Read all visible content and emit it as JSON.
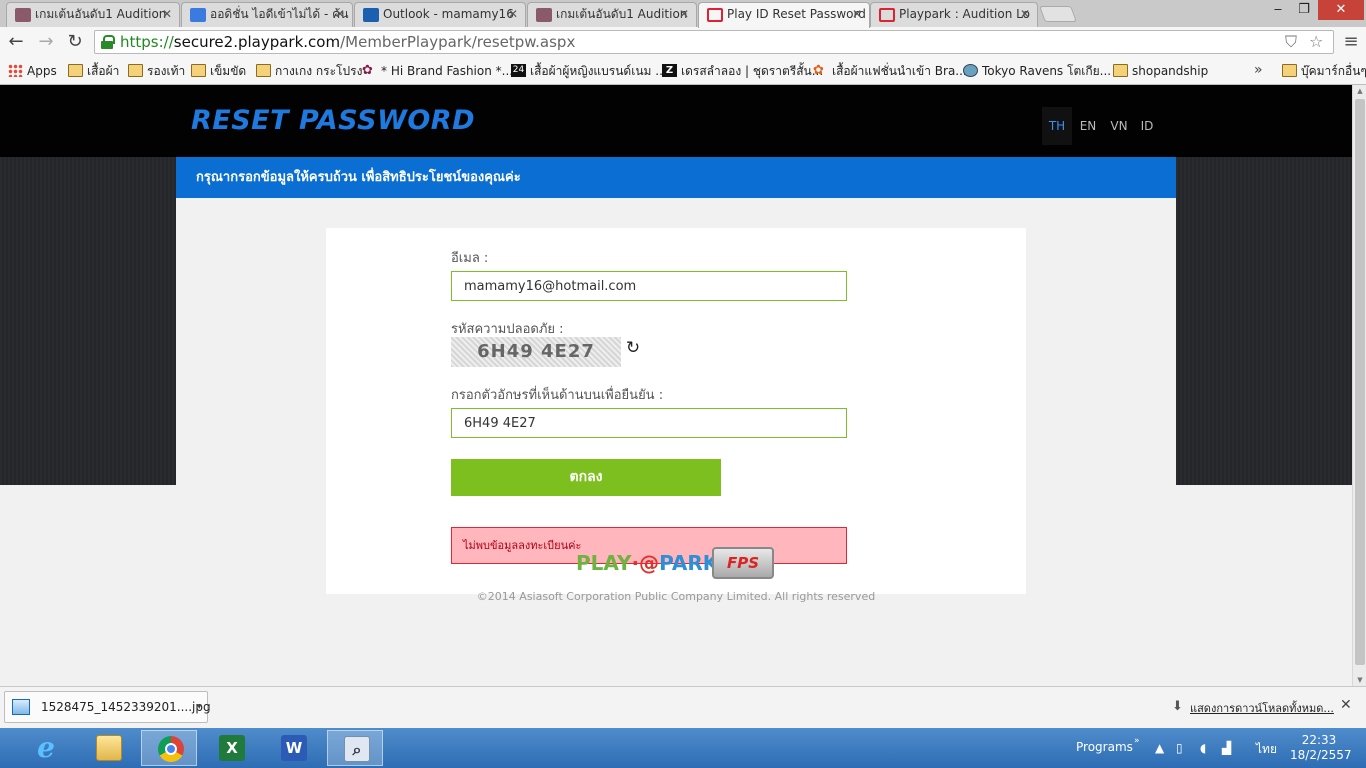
{
  "browser": {
    "tabs": [
      {
        "title": "เกมเต้นอันดับ1 Audition"
      },
      {
        "title": "ออดิชั่น ไอดีเข้าไม่ได้ - ค้น"
      },
      {
        "title": "Outlook - mamamy16"
      },
      {
        "title": "เกมเต้นอันดับ1 Audition"
      },
      {
        "title": "Play ID Reset Password"
      },
      {
        "title": "Playpark : Audition Lo"
      }
    ],
    "url": {
      "scheme": "https://",
      "host": "secure2.playpark.com",
      "path": "/MemberPlaypark/resetpw.aspx"
    },
    "bookmarks": [
      {
        "label": "Apps",
        "icon": "apps-icon"
      },
      {
        "label": "เสื้อผ้า",
        "icon": "folder-icon"
      },
      {
        "label": "รองเท้า",
        "icon": "folder-icon"
      },
      {
        "label": "เข็มขัด",
        "icon": "folder-icon"
      },
      {
        "label": "กางเกง กระโปรง",
        "icon": "folder-icon"
      },
      {
        "label": "* Hi Brand Fashion *...",
        "icon": "flower-icon"
      },
      {
        "label": "เสื้อผ้าผู้หญิงแบรนด์เนม ...",
        "icon": "site-24-icon"
      },
      {
        "label": "เดรสลำลอง | ชุดราตรีสั้น...",
        "icon": "site-z-icon"
      },
      {
        "label": "เสื้อผ้าแฟชั่นนำเข้า Bra...",
        "icon": "flower-icon"
      },
      {
        "label": "Tokyo Ravens โตเกีย...",
        "icon": "globe-icon"
      },
      {
        "label": "shopandship",
        "icon": "folder-icon"
      }
    ],
    "bookmarks_overflow": "»",
    "other_bookmarks": "บุ๊คมาร์กอื่นๆ"
  },
  "page": {
    "header_title": "RESET PASSWORD",
    "languages": [
      {
        "code": "TH",
        "active": true
      },
      {
        "code": "EN",
        "active": false
      },
      {
        "code": "VN",
        "active": false
      },
      {
        "code": "ID",
        "active": false
      }
    ],
    "banner_text": "กรุณากรอกข้อมูลให้ครบถ้วน เพื่อสิทธิประโยชน์ของคุณค่ะ",
    "form": {
      "email_label": "อีเมล :",
      "email_value": "mamamy16@hotmail.com",
      "captcha_label": "รหัสความปลอดภัย :",
      "captcha_text": "6H49 4E27",
      "confirm_label": "กรอกตัวอักษรที่เห็นด้านบนเพื่อยืนยัน :",
      "confirm_value": "6H49 4E27",
      "submit_label": "ตกลง",
      "error_message": "ไม่พบข้อมูลลงทะเบียนค่ะ"
    },
    "footer": {
      "logo_parts": [
        "PLAY",
        "·@",
        "PARK"
      ],
      "fps_badge": "FPS",
      "copyright": "©2014 Asiasoft Corporation Public Company Limited. All rights reserved"
    }
  },
  "downloads": {
    "file_name": "1528475_1452339201....jpg",
    "show_all": "แสดงการดาวน์โหลดทั้งหมด..."
  },
  "taskbar": {
    "programs_label": "Programs",
    "language": "ไทย",
    "time": "22:33",
    "date": "18/2/2557"
  },
  "colors": {
    "accent_blue": "#0a6ed2",
    "header_title": "#1f7ae0",
    "submit_green": "#7dbf1f",
    "error_bg": "#ffb6bd",
    "error_border": "#e0283a"
  }
}
